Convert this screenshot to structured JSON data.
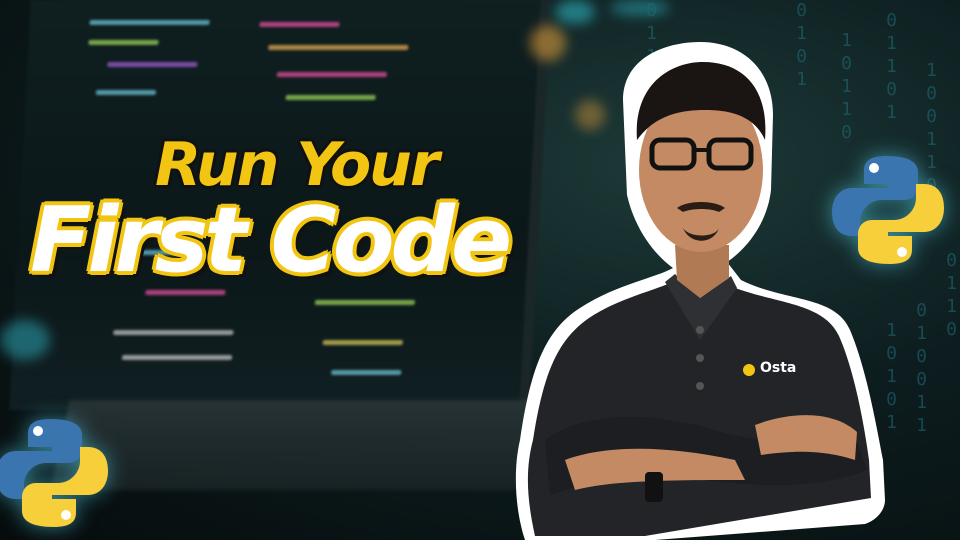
{
  "headline": {
    "line1": "Run Your",
    "line2": "First Code"
  },
  "presenter": {
    "shirt_logo_text": "Osta"
  },
  "colors": {
    "accent_yellow": "#f2c513",
    "python_blue": "#3a75b0",
    "python_yellow": "#f7cf3b",
    "background_teal": "#0d1d1f"
  },
  "icons": {
    "top_right": "python-logo-icon",
    "bottom_left": "python-logo-icon"
  }
}
